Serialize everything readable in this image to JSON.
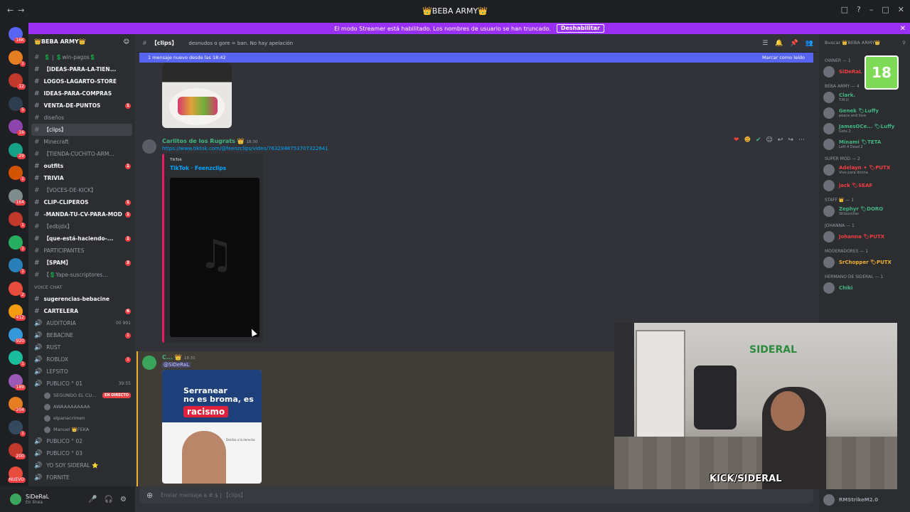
{
  "window": {
    "title": "👑BEBA ARMY👑"
  },
  "banner": {
    "text": "El modo Streamer está habilitado. Los nombres de usuario se han truncado.",
    "button": "Deshabilitar"
  },
  "guild_badges": [
    "16K",
    "1",
    "12",
    "5",
    "16",
    "29",
    "1",
    "164",
    "1",
    "1",
    "1",
    "2",
    "412",
    "920",
    "1",
    "189",
    "204",
    "1",
    "200",
    "NUEVO"
  ],
  "server": {
    "name": "👑BEBA ARMY👑"
  },
  "channels": [
    {
      "name": "💲 | 💲win-pagos💲",
      "type": "text",
      "unread": false
    },
    {
      "name": "【IDEAS-PARA-LA-TIEN...",
      "type": "text",
      "unread": true
    },
    {
      "name": "LOGOS-LAGARTO-STORE",
      "type": "text",
      "unread": true
    },
    {
      "name": "IDEAS-PARA-COMPRAS",
      "type": "text",
      "unread": true
    },
    {
      "name": "VENTA-DE-PUNTOS",
      "type": "text",
      "unread": true,
      "badge": "1"
    },
    {
      "name": "diseños",
      "type": "text",
      "unread": false
    },
    {
      "name": "【clips】",
      "type": "text",
      "unread": false,
      "active": true
    },
    {
      "name": "Minecraft",
      "type": "text",
      "unread": false
    },
    {
      "name": "【TIENDA-CUCHITO-ARM...",
      "type": "text",
      "unread": false
    },
    {
      "name": "outfits",
      "type": "text",
      "unread": true,
      "badge": "1"
    },
    {
      "name": "TRIVIA",
      "type": "text",
      "unread": true
    },
    {
      "name": "【VOCES-DE-KICK】",
      "type": "text",
      "unread": false
    },
    {
      "name": "CLIP-CLIPEROS",
      "type": "text",
      "unread": true,
      "badge": "1"
    },
    {
      "name": "-MANDA-TU-CV-PARA-MOD",
      "type": "text",
      "unread": true,
      "badge": "1"
    },
    {
      "name": "【edbjdx】",
      "type": "text",
      "unread": false
    },
    {
      "name": "【que-está-haciendo-...",
      "type": "text",
      "unread": true,
      "badge": "1"
    },
    {
      "name": "PARTICIPANTES",
      "type": "text",
      "unread": false
    },
    {
      "name": "【SPAM】",
      "type": "text",
      "unread": true,
      "badge": "3"
    },
    {
      "name": "【💲Yape-suscriptores...",
      "type": "text",
      "unread": false
    }
  ],
  "voice_category": "VOICE CHAT",
  "voice_channels": [
    {
      "name": "sugerencias-bebacine",
      "unread": true
    },
    {
      "name": "CARTELERA",
      "unread": true,
      "badge": "6"
    },
    {
      "name": "AUDITORIA",
      "count": "00 991"
    },
    {
      "name": "BEBACINE",
      "badge": "1"
    },
    {
      "name": "RUST"
    },
    {
      "name": "ROBLOX",
      "badge": "1"
    },
    {
      "name": "LEFSITO"
    },
    {
      "name": "PUBLICO ° 01",
      "count": "39:55"
    }
  ],
  "voice_users": [
    {
      "name": "SEGUNDO EL CU...",
      "live": "EN DIRECTO"
    },
    {
      "name": "AWAAAAAAAAA"
    },
    {
      "name": "elpanacrimen"
    },
    {
      "name": "Manuel 👑FEKA"
    }
  ],
  "voice_channels_2": [
    {
      "name": "PUBLICO ° 02"
    },
    {
      "name": "PUBLICO ° 03"
    },
    {
      "name": "YO SOY SIDERAL ⭐"
    },
    {
      "name": "FORNITE"
    }
  ],
  "user": {
    "name": "SiDeRaL",
    "status": "En línea"
  },
  "topbar": {
    "channel": "【clips】",
    "topic": "desnudos o gore = ban. No hay apelación"
  },
  "new_messages": {
    "text": "1 mensaje nuevo desde las 18:42",
    "mark": "Marcar como leído"
  },
  "messages": [
    {
      "author": "Carlitos de los Rugrats 👑",
      "time": "18:30",
      "link": "https://www.tiktok.com/@feenzclips/video/7632848753707322641",
      "embed": {
        "provider": "TikTok",
        "title": "TikTok · Feenzclips"
      }
    },
    {
      "author": "C... 👑",
      "time": "18:31",
      "mention": "@SiDeRaL",
      "poster": {
        "line1": "Serranear",
        "line2": "no es broma, es",
        "line3": "racismo",
        "caption": "Desliza a la derecha"
      }
    }
  ],
  "composer": {
    "placeholder": "Enviar mensaje a # $ | 【clips】"
  },
  "members": {
    "search": "Buscar 👑BEBA ARMY👑",
    "groups": [
      {
        "label": "OWNER — 1",
        "items": [
          {
            "name": "SiDeRaL",
            "color": "#f23f43"
          }
        ]
      },
      {
        "label": "BEBA ARMY — 4",
        "items": [
          {
            "name": "Clark.",
            "status": "T.M.U",
            "color": "#43b581"
          },
          {
            "name": "Genek 🏷Luffy",
            "status": "peace and love",
            "color": "#43b581"
          },
          {
            "name": "JamesOCe... 🏷Luffy",
            "status": "Gota 2",
            "color": "#43b581"
          },
          {
            "name": "Minami 🏷TETA",
            "status": "Left 4 Dead 2",
            "color": "#43b581"
          }
        ]
      },
      {
        "label": "SUPER MOD — 2",
        "items": [
          {
            "name": "Adelayn ✦ 🏷PUTX",
            "status": "Vivo para donna",
            "color": "#f23f43"
          },
          {
            "name": "jack 🏷SEAF",
            "status": "",
            "color": "#f23f43"
          }
        ]
      },
      {
        "label": "STAFF 👑 — 1",
        "items": [
          {
            "name": "Zephyr 🏷DORO",
            "status": "SKlauncher",
            "color": "#43b581"
          }
        ]
      },
      {
        "label": "Johanna — 1",
        "items": [
          {
            "name": "Johanna 🏷PUTX",
            "status": "",
            "color": "#f23f43"
          }
        ]
      },
      {
        "label": "MODERADORES — 1",
        "items": [
          {
            "name": "SrChopper 🏷PUTX",
            "status": "",
            "color": "#f0b232"
          }
        ]
      },
      {
        "label": "hermano de sideral — 1",
        "items": [
          {
            "name": "Chiki",
            "status": "",
            "color": "#43b581"
          }
        ]
      }
    ],
    "bottom": "RMStrikeM2.0"
  },
  "age_badge": "18",
  "stream": {
    "brand": "KICK/SIDERAL",
    "wall_logo": "SIDERAL"
  },
  "colors": {
    "banner": "#9b30f5",
    "accent": "#5865f2",
    "unread": "#f23f43"
  }
}
